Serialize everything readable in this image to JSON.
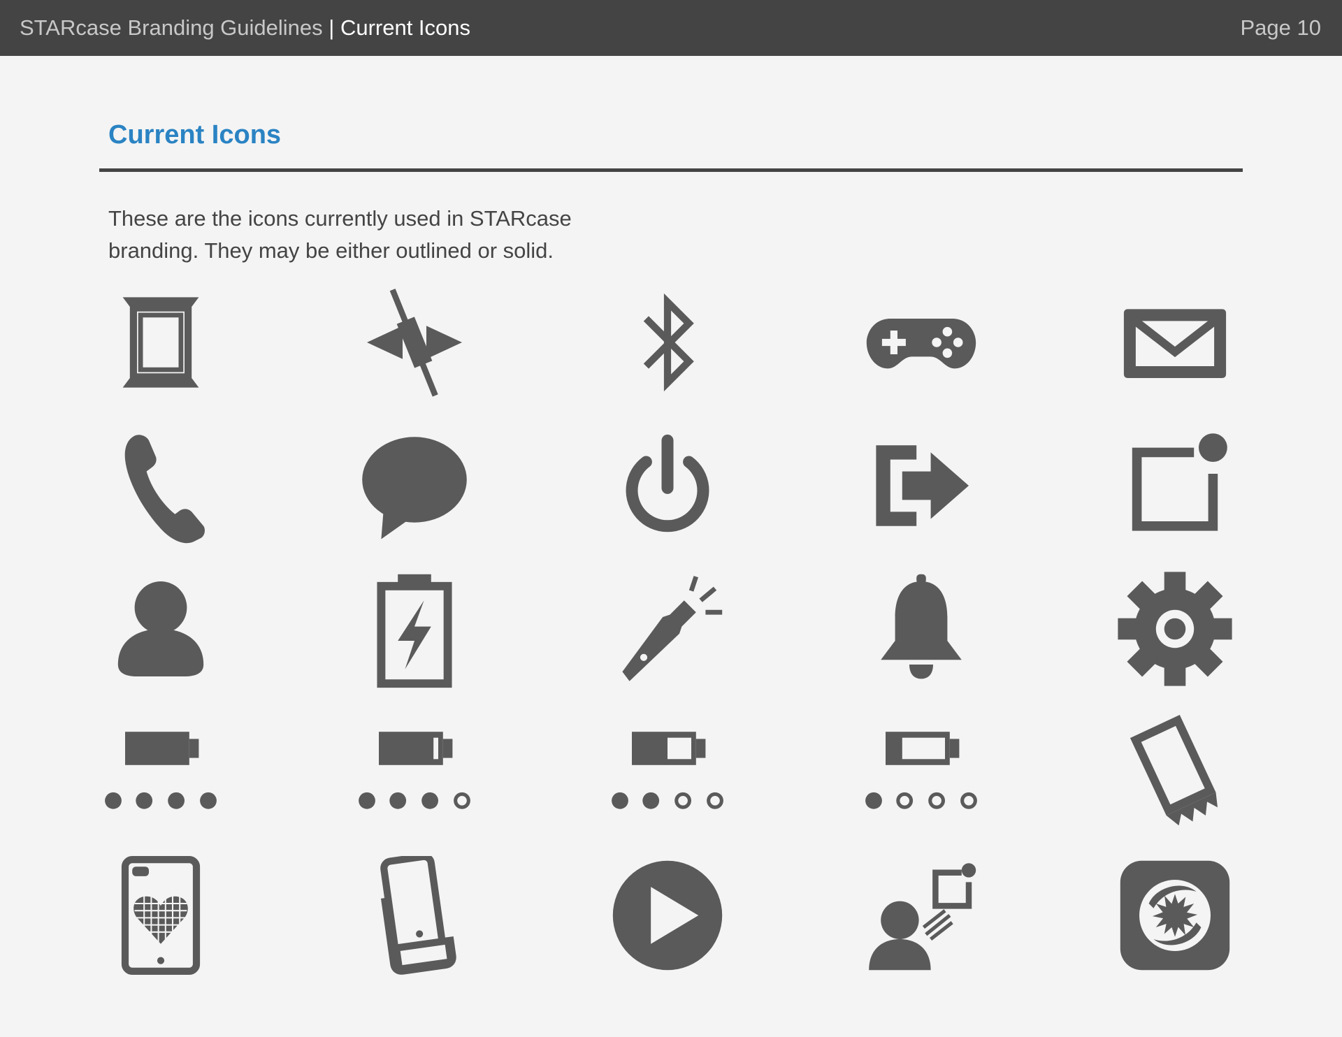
{
  "header": {
    "doc_title": "STARcase Branding Guidelines",
    "separator": " | ",
    "section": "Current Icons",
    "page": "Page 10"
  },
  "section_title": "Current Icons",
  "intro": "These are the icons currently used in STARcase branding. They may be either outlined or solid.",
  "icon_color": "#5a5a5a",
  "title_color": "#2a83c3",
  "header_bg": "#444444",
  "icons": [
    "screen-frame-icon",
    "vibrate-off-icon",
    "bluetooth-icon",
    "gamepad-icon",
    "mail-icon",
    "phone-icon",
    "chat-bubble-icon",
    "power-icon",
    "logout-arrow-icon",
    "notification-square-icon",
    "user-icon",
    "battery-charging-icon",
    "flashlight-icon",
    "bell-icon",
    "gear-icon",
    "battery-full-4-dots-icon",
    "battery-75-3-dots-icon",
    "battery-50-2-dots-icon",
    "battery-25-1-dot-icon",
    "tilted-phone-icon",
    "phone-case-heart-icon",
    "phone-case-slide-icon",
    "play-icon",
    "user-share-icon",
    "starcase-app-logo-icon"
  ]
}
